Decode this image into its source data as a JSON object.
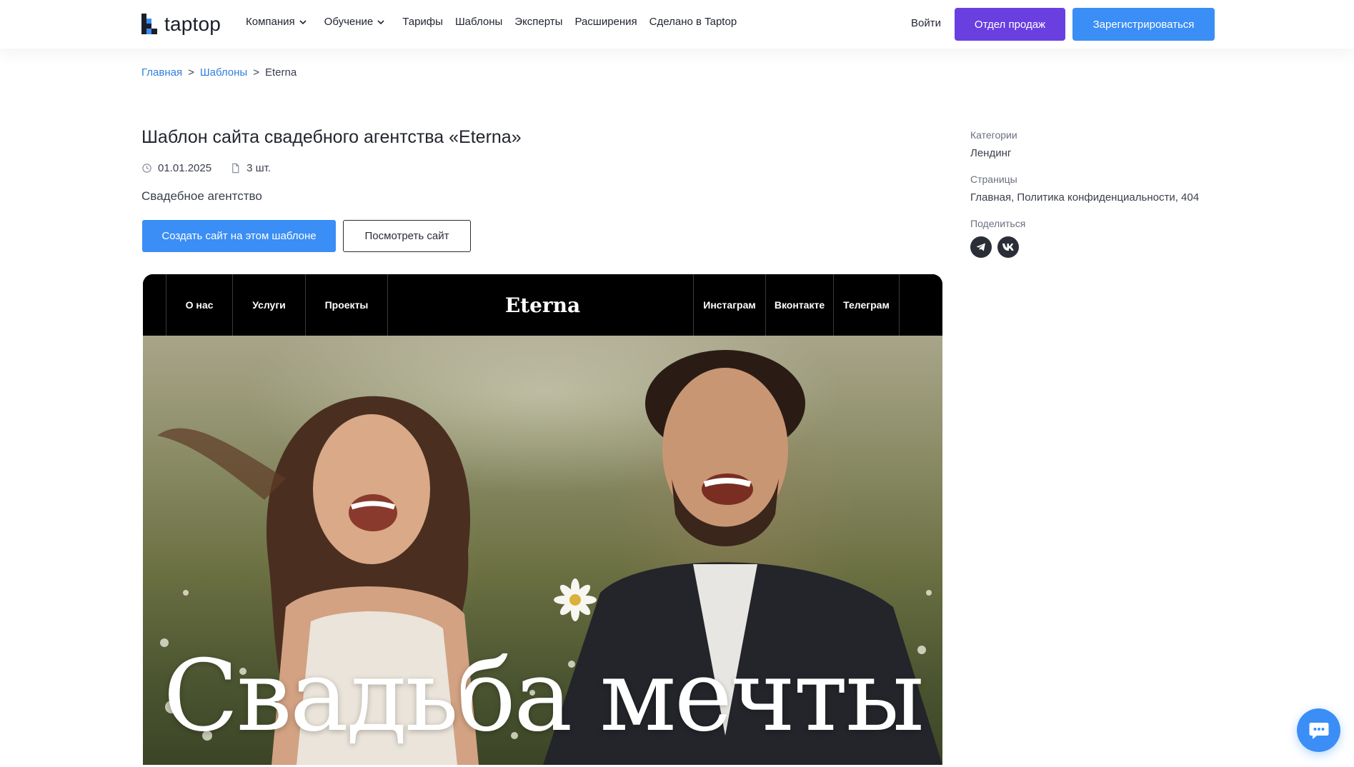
{
  "header": {
    "logo_text": "taptop",
    "nav": [
      {
        "label": "Компания",
        "has_dropdown": true
      },
      {
        "label": "Обучение",
        "has_dropdown": true
      },
      {
        "label": "Тарифы",
        "has_dropdown": false
      },
      {
        "label": "Шаблоны",
        "has_dropdown": false
      },
      {
        "label": "Эксперты",
        "has_dropdown": false
      },
      {
        "label": "Расширения",
        "has_dropdown": false
      },
      {
        "label": "Сделано в Taptop",
        "has_dropdown": false
      }
    ],
    "login": "Войти",
    "sales_button": "Отдел продаж",
    "register_button": "Зарегистрироваться"
  },
  "breadcrumb": {
    "items": [
      "Главная",
      "Шаблоны",
      "Eterna"
    ],
    "separator": ">"
  },
  "template": {
    "title": "Шаблон сайта свадебного агентства «Eterna»",
    "date": "01.01.2025",
    "pages_count": "3 шт.",
    "description": "Свадебное агентство",
    "create_button": "Создать сайт на этом шаблоне",
    "view_button": "Посмотреть сайт"
  },
  "preview": {
    "nav_left": [
      "О нас",
      "Услуги",
      "Проекты"
    ],
    "brand": "Eterna",
    "nav_right": [
      "Инстаграм",
      "Вконтакте",
      "Телеграм"
    ],
    "headline": "Свадьба мечты"
  },
  "sidebar": {
    "categories_label": "Категории",
    "categories_value": "Лендинг",
    "pages_label": "Страницы",
    "pages_value": "Главная, Политика конфиденциальности, 404",
    "share_label": "Поделиться",
    "share_icons": [
      "telegram-icon",
      "vk-icon"
    ]
  },
  "colors": {
    "accent_blue": "#3a8ef5",
    "accent_purple": "#6a3fe0",
    "link_blue": "#2f7fe0"
  }
}
